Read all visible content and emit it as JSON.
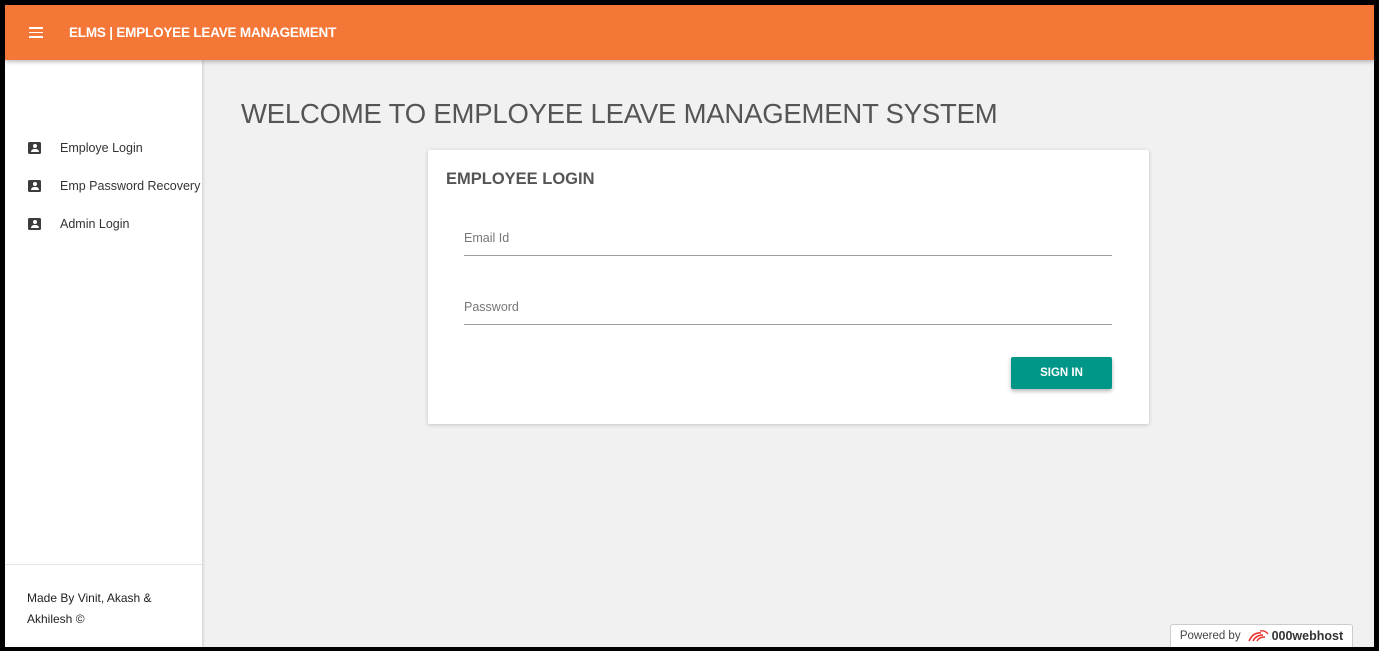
{
  "header": {
    "brand": "ELMS | EMPLOYEE LEAVE MANAGEMENT"
  },
  "sidebar": {
    "items": [
      {
        "label": "Employe Login",
        "icon": "account-box-icon"
      },
      {
        "label": "Emp Password Recovery",
        "icon": "account-box-icon"
      },
      {
        "label": "Admin Login",
        "icon": "account-box-icon"
      }
    ],
    "footer": {
      "line1": "Made By Vinit, Akash &",
      "line2": "Akhilesh ©"
    }
  },
  "main": {
    "title": "WELCOME TO EMPLOYEE LEAVE MANAGEMENT SYSTEM",
    "login": {
      "title": "EMPLOYEE LOGIN",
      "email_placeholder": "Email Id",
      "email_value": "",
      "password_placeholder": "Password",
      "password_value": "",
      "signin_label": "SIGN IN"
    }
  },
  "badge": {
    "prefix": "Powered by",
    "host": "000webhost"
  },
  "colors": {
    "topbar": "#f57738",
    "button": "#009688",
    "background": "#f1f1f1",
    "badge_logo": "#e8322b"
  }
}
